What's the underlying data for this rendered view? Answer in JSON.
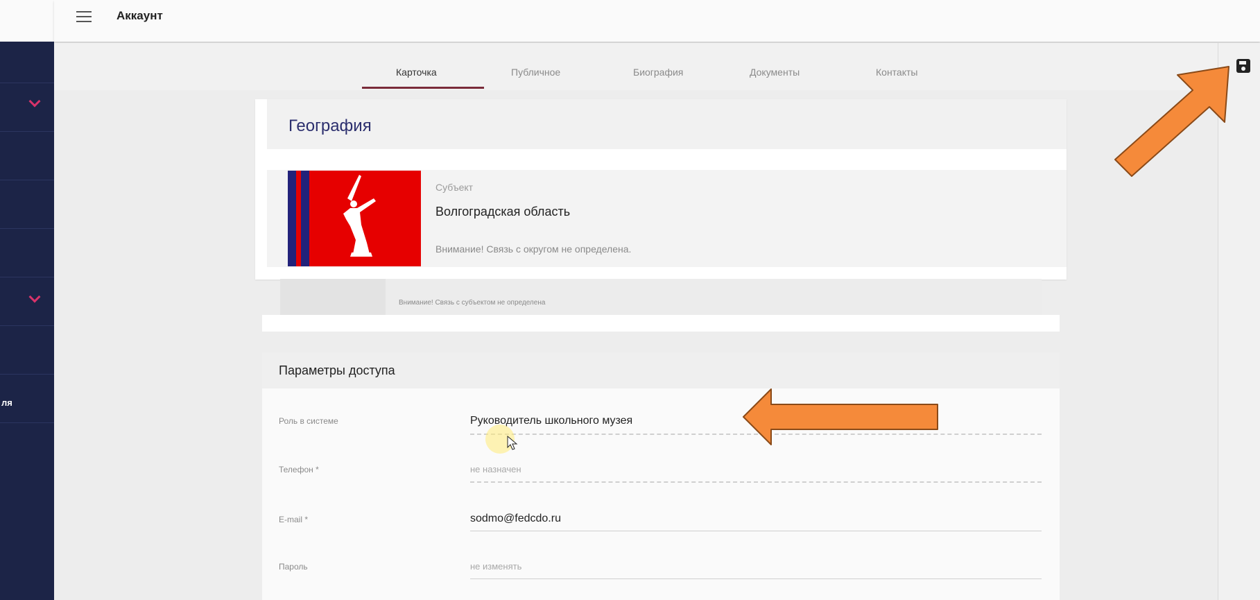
{
  "header": {
    "title": "Аккаунт"
  },
  "tabs": [
    {
      "label": "Карточка",
      "active": true
    },
    {
      "label": "Публичное",
      "active": false
    },
    {
      "label": "Биография",
      "active": false
    },
    {
      "label": "Документы",
      "active": false
    },
    {
      "label": "Контакты",
      "active": false
    }
  ],
  "sidebar": {
    "partial_item_label": "ля"
  },
  "geography": {
    "title": "География",
    "subject_label": "Субъект",
    "subject_value": "Волгоградская область",
    "district_warning": "Внимание! Связь с округом не определена.",
    "subject_warning": "Внимание! Связь с субъектом не определена"
  },
  "access": {
    "title": "Параметры доступа",
    "role": {
      "label": "Роль в системе",
      "value": "Руководитель школьного музея"
    },
    "phone": {
      "label": "Телефон *",
      "placeholder": "не назначен"
    },
    "email": {
      "label": "E-mail *",
      "value": "sodmo@fedcdo.ru"
    },
    "password": {
      "label": "Пароль",
      "placeholder": "не изменять"
    }
  },
  "colors": {
    "sidebar": "#1c2447",
    "accent": "#d8336a",
    "tab_underline": "#7a2b3a",
    "arrow": "#f58a3a",
    "flag_red": "#e60000",
    "flag_blue": "#22227a"
  }
}
